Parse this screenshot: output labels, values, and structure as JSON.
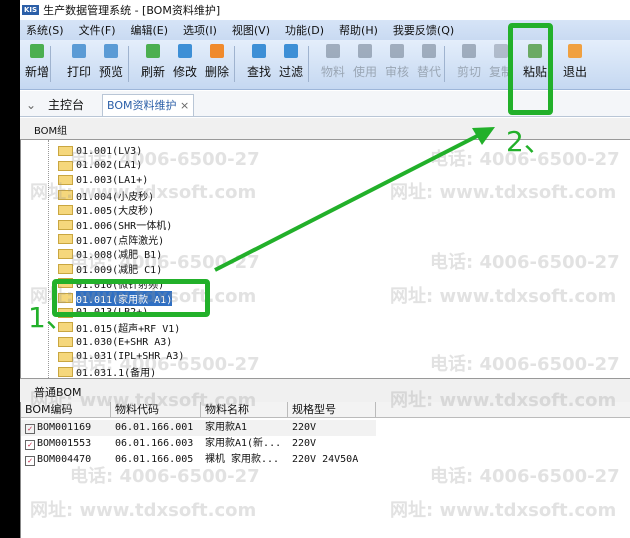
{
  "window": {
    "title": "生产数据管理系统 - [BOM资料维护]",
    "logo": "KIS"
  },
  "menu": [
    "系统(S)",
    "文件(F)",
    "编辑(E)",
    "选项(I)",
    "视图(V)",
    "功能(D)",
    "帮助(H)",
    "我要反馈(Q)"
  ],
  "toolbar": [
    {
      "label": "新增",
      "icon": "add-icon",
      "color": "#4caf50",
      "enabled": true
    },
    {
      "label": "打印",
      "icon": "print-icon",
      "color": "#5b9bd5",
      "enabled": true
    },
    {
      "label": "预览",
      "icon": "preview-icon",
      "color": "#5b9bd5",
      "enabled": true
    },
    {
      "label": "刷新",
      "icon": "refresh-icon",
      "color": "#4caf50",
      "enabled": true
    },
    {
      "label": "修改",
      "icon": "edit-icon",
      "color": "#3d8fd6",
      "enabled": true
    },
    {
      "label": "删除",
      "icon": "delete-icon",
      "color": "#f08a2c",
      "enabled": true
    },
    {
      "label": "查找",
      "icon": "search-icon",
      "color": "#3d8fd6",
      "enabled": true
    },
    {
      "label": "过滤",
      "icon": "filter-icon",
      "color": "#3d8fd6",
      "enabled": true
    },
    {
      "label": "物料",
      "icon": "material-icon",
      "color": "#6c7a8c",
      "enabled": false
    },
    {
      "label": "使用",
      "icon": "usage-icon",
      "color": "#6c7a8c",
      "enabled": false
    },
    {
      "label": "审核",
      "icon": "audit-icon",
      "color": "#6c7a8c",
      "enabled": false
    },
    {
      "label": "替代",
      "icon": "substitute-icon",
      "color": "#6c7a8c",
      "enabled": false
    },
    {
      "label": "剪切",
      "icon": "cut-icon",
      "color": "#6c7a8c",
      "enabled": false
    },
    {
      "label": "复制",
      "icon": "copy-icon",
      "color": "#8a95a5",
      "enabled": false
    },
    {
      "label": "粘贴",
      "icon": "paste-icon",
      "color": "#6aaa64",
      "enabled": true
    },
    {
      "label": "退出",
      "icon": "exit-icon",
      "color": "#f0a040",
      "enabled": true
    }
  ],
  "tabs": [
    {
      "label": "主控台"
    },
    {
      "label": "BOM资料维护",
      "close": "×",
      "active": true
    }
  ],
  "bom_group": {
    "title": "BOM组",
    "items": [
      "01.001(LV3)",
      "01.002(LA1)",
      "01.003(LA1+)",
      "01.004(小皮秒)",
      "01.005(大皮秒)",
      "01.006(SHR一体机)",
      "01.007(点阵激光)",
      "01.008(减肥 B1)",
      "01.009(减肥 C1)",
      "01.010(微针射频)",
      "01.011(家用款 A1)",
      "01.013(LB2+)",
      "01.015(超声+RF V1)",
      "01.030(E+SHR A3)",
      "01.031(IPL+SHR A3)",
      "01.031.1(备用)"
    ],
    "selected": "01.011(家用款 A1)"
  },
  "bom_list": {
    "title": "普通BOM",
    "columns": [
      "BOM编码",
      "物料代码",
      "物料名称",
      "规格型号"
    ],
    "rows": [
      [
        "BOM001169",
        "06.01.166.001",
        "家用款A1",
        "220V"
      ],
      [
        "BOM001553",
        "06.01.166.003",
        "家用款A1(新...",
        "220V"
      ],
      [
        "BOM004470",
        "06.01.166.005",
        "裸机 家用款...",
        "220V 24V50A"
      ]
    ]
  },
  "watermark": {
    "phone": "电话: 4006-6500-27",
    "site": "网址: www.tdxsoft.com"
  },
  "annotations": {
    "step1": "1、",
    "step2": "2、",
    "color": "#22b02a"
  }
}
